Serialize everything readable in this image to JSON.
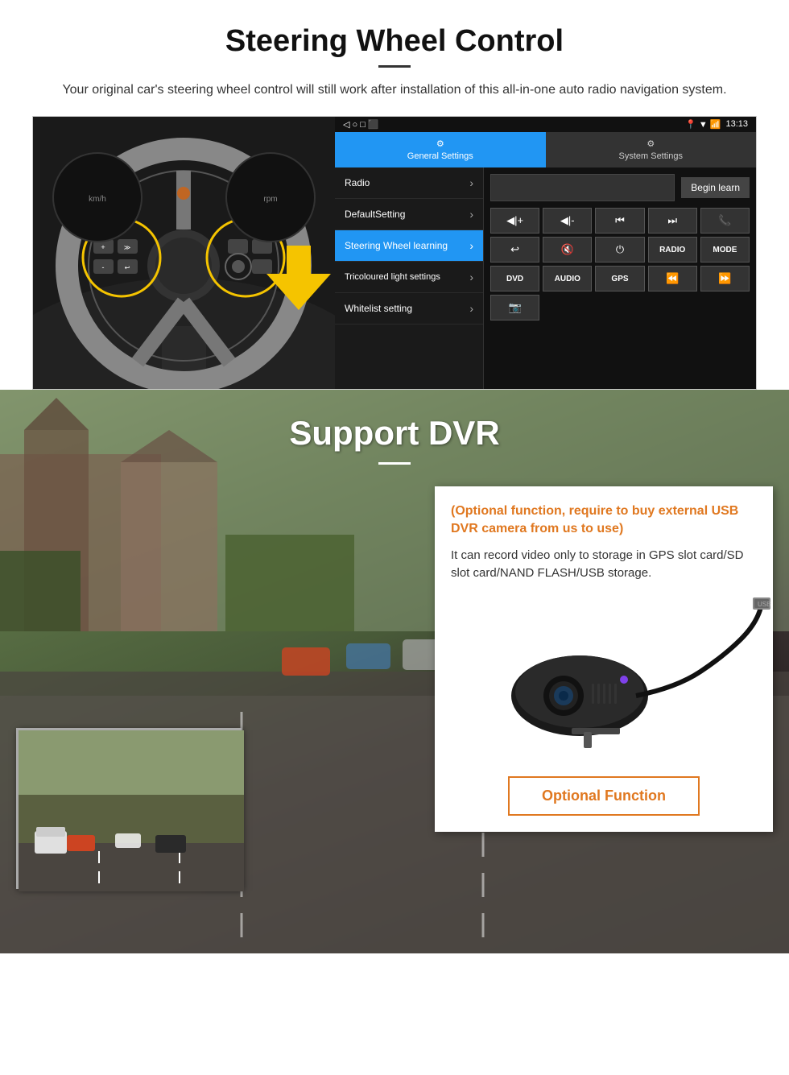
{
  "section1": {
    "title": "Steering Wheel Control",
    "subtitle": "Your original car's steering wheel control will still work after installation of this all-in-one auto radio navigation system.",
    "status_bar": {
      "time": "13:13",
      "icons": "▼ 📶"
    },
    "tabs": {
      "general": "General Settings",
      "system": "System Settings"
    },
    "menu_items": [
      {
        "label": "Radio",
        "active": false
      },
      {
        "label": "DefaultSetting",
        "active": false
      },
      {
        "label": "Steering Wheel learning",
        "active": true
      },
      {
        "label": "Tricoloured light settings",
        "active": false
      },
      {
        "label": "Whitelist setting",
        "active": false
      }
    ],
    "begin_learn": "Begin learn",
    "control_buttons": [
      {
        "symbol": "◀|+",
        "type": "symbol"
      },
      {
        "symbol": "◀|-",
        "type": "symbol"
      },
      {
        "symbol": "⏮",
        "type": "symbol"
      },
      {
        "symbol": "⏭",
        "type": "symbol"
      },
      {
        "symbol": "📞",
        "type": "symbol"
      },
      {
        "symbol": "↩",
        "type": "symbol"
      },
      {
        "symbol": "🔇",
        "type": "symbol"
      },
      {
        "symbol": "⏻",
        "type": "symbol"
      },
      {
        "symbol": "RADIO",
        "type": "text"
      },
      {
        "symbol": "MODE",
        "type": "text"
      },
      {
        "symbol": "DVD",
        "type": "text"
      },
      {
        "symbol": "AUDIO",
        "type": "text"
      },
      {
        "symbol": "GPS",
        "type": "text"
      },
      {
        "symbol": "⏪",
        "type": "symbol"
      },
      {
        "symbol": "⏩",
        "type": "symbol"
      },
      {
        "symbol": "📷",
        "type": "symbol"
      }
    ]
  },
  "section2": {
    "title": "Support DVR",
    "info_orange": "(Optional function, require to buy external USB DVR camera from us to use)",
    "info_text": "It can record video only to storage in GPS slot card/SD slot card/NAND FLASH/USB storage.",
    "optional_btn": "Optional Function"
  }
}
